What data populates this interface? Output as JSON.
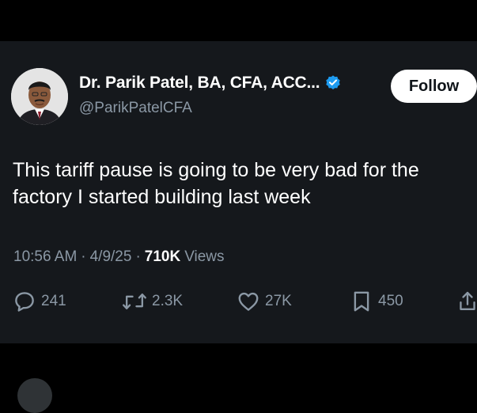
{
  "tweet": {
    "author": {
      "display_name": "Dr. Parik Patel, BA, CFA, ACC...",
      "handle": "@ParikPatelCFA",
      "verified": true
    },
    "follow_label": "Follow",
    "text_lines": [
      "This tariff pause is going to be very bad for the",
      "factory I started building last week"
    ],
    "meta": {
      "time": "10:56 AM",
      "separator": "·",
      "date": "4/9/25",
      "views_count": "710K",
      "views_label": "Views"
    },
    "actions": {
      "replies": "241",
      "reposts": "2.3K",
      "likes": "27K",
      "bookmarks": "450"
    }
  },
  "icons": {
    "verified": "verified-badge-icon",
    "reply": "reply-icon",
    "repost": "repost-icon",
    "like": "heart-icon",
    "bookmark": "bookmark-icon",
    "share": "share-icon"
  },
  "colors": {
    "background": "#000000",
    "card": "#15181c",
    "text_primary": "#ffffff",
    "text_secondary": "#8b98a5",
    "verified_blue": "#1d9bf0",
    "follow_bg": "#ffffff"
  }
}
